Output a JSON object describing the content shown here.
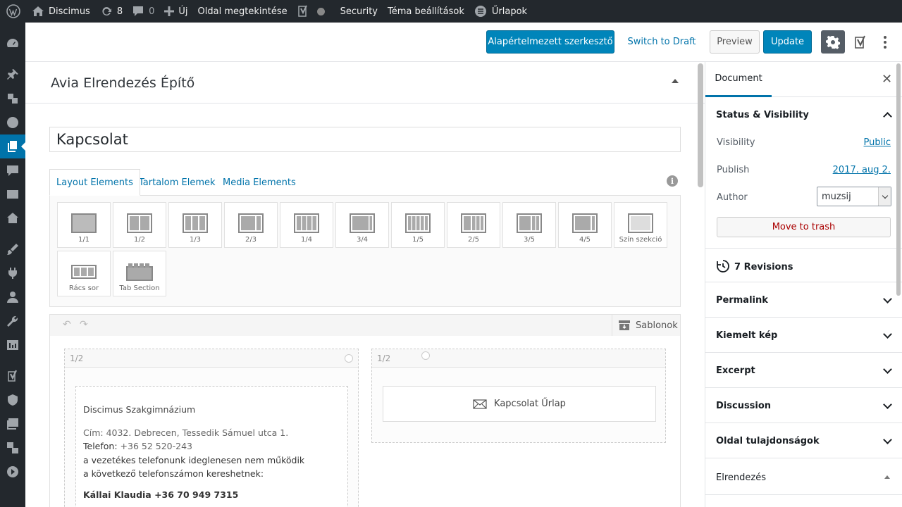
{
  "adminbar": {
    "site_name": "Discimus",
    "updates_count": "8",
    "comments_count": "0",
    "new_label": "Új",
    "view_page": "Oldal megtekintése",
    "security": "Security",
    "theme_settings": "Téma beállítások",
    "forms": "Űrlapok"
  },
  "toolbar": {
    "default_editor": "Alapértelmezett szerkesztő",
    "switch_draft": "Switch to Draft",
    "preview": "Preview",
    "update": "Update"
  },
  "builder": {
    "title": "Avia Elrendezés Építő",
    "page_title": "Kapcsolat",
    "tabs": [
      "Layout Elements",
      "Tartalom Elemek",
      "Media Elements"
    ],
    "elements": [
      "1/1",
      "1/2",
      "1/3",
      "2/3",
      "1/4",
      "3/4",
      "1/5",
      "2/5",
      "3/5",
      "4/5",
      "Szín szekció",
      "Rács sor",
      "Tab Section"
    ],
    "templates": "Sablonok"
  },
  "canvas": {
    "left_col": "1/2",
    "right_col": "1/2",
    "org_name": "Discimus Szakgimnázium",
    "addr_label": "Cím:",
    "addr_value": "4032. Debrecen, Tessedik Sámuel utca 1.",
    "phone_label": "Telefon:",
    "phone_value": "+36 52 520-243",
    "note_line1": "a vezetékes telefonunk ideglenesen nem működik",
    "note_line2": "a következő telefonszámon kereshetnek:",
    "contact_person": "Kállai Klaudia +36 70 949 7315",
    "form_label": "Kapcsolat Űrlap"
  },
  "sidebar": {
    "tab_document": "Document",
    "status_title": "Status & Visibility",
    "visibility_label": "Visibility",
    "visibility_value": "Public",
    "publish_label": "Publish",
    "publish_value": "2017. aug 2.",
    "author_label": "Author",
    "author_value": "muzsij",
    "trash": "Move to trash",
    "revisions": "7 Revisions",
    "sections": [
      "Permalink",
      "Kiemelt kép",
      "Excerpt",
      "Discussion",
      "Oldal tulajdonságok",
      "Elrendezés"
    ]
  },
  "colors": {
    "accent": "#0085ba",
    "admin_bar": "#23282d",
    "trash": "#a00"
  }
}
